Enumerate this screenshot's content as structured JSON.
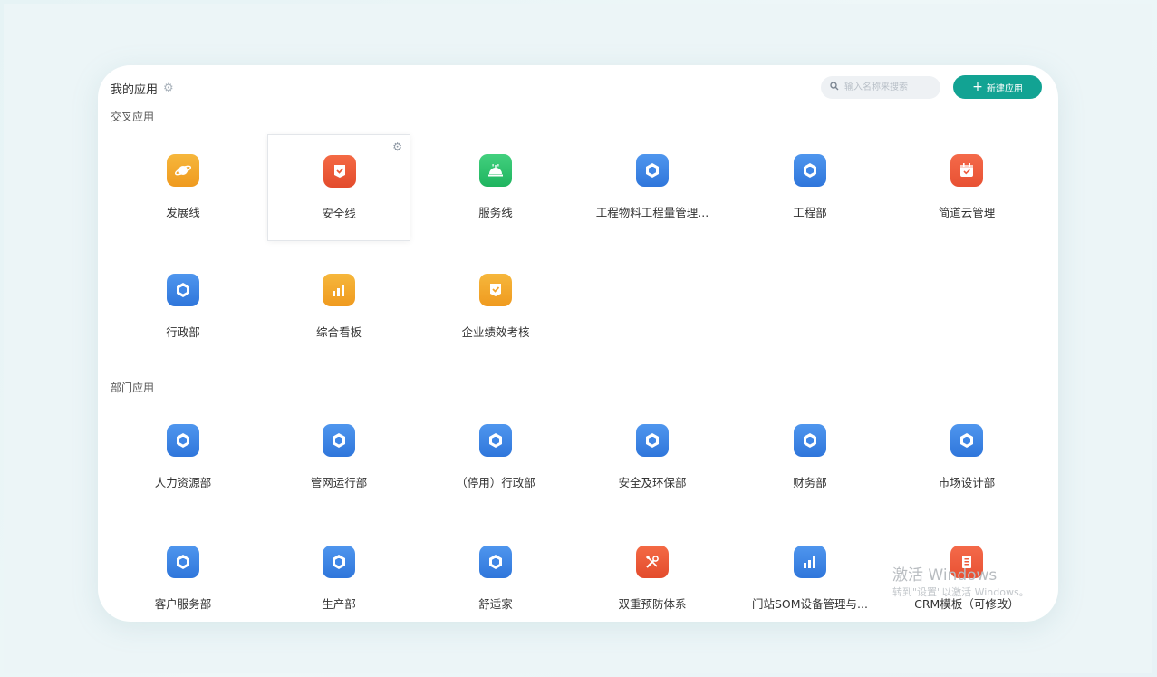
{
  "header": {
    "title": "我的应用",
    "search_placeholder": "输入名称来搜索",
    "new_app_label": "新建应用"
  },
  "sections": {
    "cross": {
      "label": "交叉应用"
    },
    "dept": {
      "label": "部门应用"
    }
  },
  "cross_apps": [
    {
      "label": "发展线",
      "icon": "planet-icon",
      "color": "#f2a52a"
    },
    {
      "label": "安全线",
      "icon": "check-badge-icon",
      "color": "#ea5a37"
    },
    {
      "label": "服务线",
      "icon": "service-bell-icon",
      "color": "#2fc16c"
    },
    {
      "label": "工程物料工程量管理...",
      "icon": "hexagon-icon",
      "color": "#3d85e6"
    },
    {
      "label": "工程部",
      "icon": "hexagon-icon",
      "color": "#3d85e6"
    },
    {
      "label": "简道云管理",
      "icon": "calendar-icon",
      "color": "#ee5b3c"
    },
    {
      "label": "行政部",
      "icon": "hexagon-icon",
      "color": "#3d85e6"
    },
    {
      "label": "综合看板",
      "icon": "bar-chart-icon",
      "color": "#f2a52a"
    },
    {
      "label": "企业绩效考核",
      "icon": "check-badge-icon",
      "color": "#f2a52a"
    }
  ],
  "dept_apps": [
    {
      "label": "人力资源部",
      "icon": "hexagon-icon"
    },
    {
      "label": "管网运行部",
      "icon": "hexagon-icon"
    },
    {
      "label": "（停用）行政部",
      "icon": "hexagon-icon"
    },
    {
      "label": "安全及环保部",
      "icon": "hexagon-icon"
    },
    {
      "label": "财务部",
      "icon": "hexagon-icon"
    },
    {
      "label": "市场设计部",
      "icon": "hexagon-icon"
    },
    {
      "label": "客户服务部",
      "icon": "hexagon-icon"
    },
    {
      "label": "生产部",
      "icon": "hexagon-icon"
    },
    {
      "label": "舒适家",
      "icon": "hexagon-icon"
    },
    {
      "label": "双重预防体系",
      "icon": "tools-icon"
    },
    {
      "label": "门站SOM设备管理与...",
      "icon": "bar-chart-icon"
    },
    {
      "label": "CRM模板（可修改）",
      "icon": "building-icon"
    }
  ],
  "watermark": {
    "line1": "激活 Windows",
    "line2": "转到\"设置\"以激活 Windows。"
  }
}
